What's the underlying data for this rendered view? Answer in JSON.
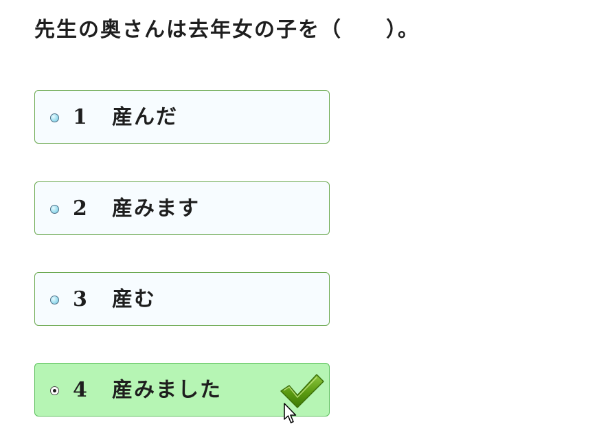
{
  "question": {
    "text": "先生の奥さんは去年女の子を（　　）。"
  },
  "options": [
    {
      "number": "1",
      "label": "産んだ",
      "selected": false
    },
    {
      "number": "2",
      "label": "産みます",
      "selected": false
    },
    {
      "number": "3",
      "label": "産む",
      "selected": false
    },
    {
      "number": "4",
      "label": "産みました",
      "selected": true,
      "correct": true
    }
  ],
  "icons": {
    "check": "checkmark-icon",
    "cursor": "mouse-pointer-icon"
  },
  "colors": {
    "option_border": "#6aa84f",
    "option_bg": "#f7fcff",
    "correct_bg": "#b6f5b4",
    "check_green": "#5a9a10"
  }
}
